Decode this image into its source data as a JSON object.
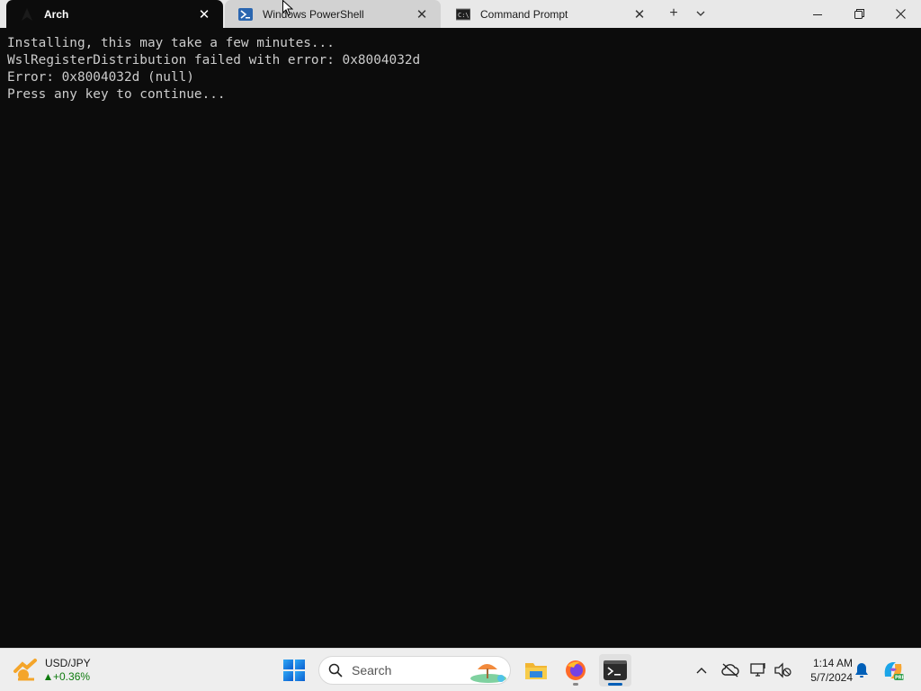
{
  "tabs": [
    {
      "label": "Arch",
      "icon": "arch-icon",
      "state": "active"
    },
    {
      "label": "Windows PowerShell",
      "icon": "powershell-icon",
      "state": "hover"
    },
    {
      "label": "Command Prompt",
      "icon": "cmd-icon",
      "state": "inactive"
    }
  ],
  "tab_close_glyph": "✕",
  "new_tab_glyph": "+",
  "tab_menu_glyph": "⌄",
  "window_controls": {
    "minimize": "minimize-icon",
    "maximize": "restore-icon",
    "close": "close-icon"
  },
  "terminal": {
    "lines": [
      "Installing, this may take a few minutes...",
      "WslRegisterDistribution failed with error: 0x8004032d",
      "Error: 0x8004032d (null)",
      "Press any key to continue..."
    ],
    "background": "#0c0c0c",
    "foreground": "#cccccc"
  },
  "taskbar": {
    "widget": {
      "title": "USD/JPY",
      "change": "+0.36%"
    },
    "search_placeholder": "Search",
    "apps": [
      "file-explorer-icon",
      "firefox-icon",
      "terminal-icon"
    ],
    "clock": {
      "time": "1:14 AM",
      "date": "5/7/2024"
    }
  },
  "colors": {
    "accent": "#005fb8",
    "positive": "#0f7b0f"
  }
}
